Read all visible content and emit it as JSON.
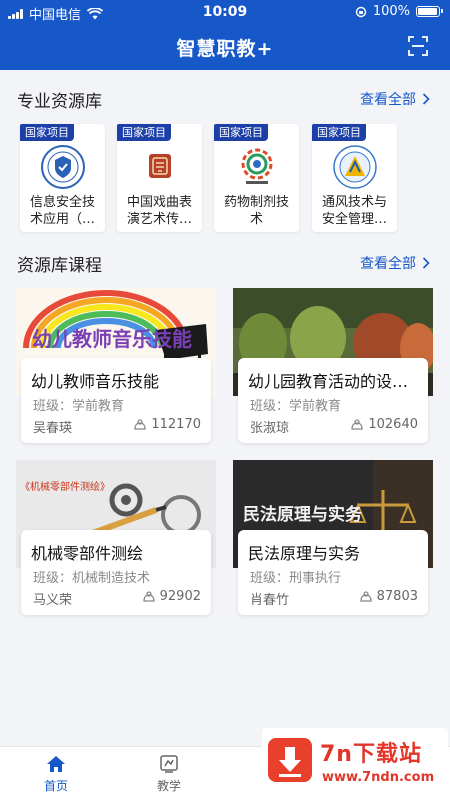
{
  "status": {
    "carrier": "中国电信",
    "time": "10:09",
    "battery": "100%"
  },
  "nav": {
    "title": "智慧职教+"
  },
  "section_resources": {
    "title": "专业资源库",
    "more": "查看全部"
  },
  "resources": [
    {
      "tag": "国家项目",
      "name": "信息安全技术应用（…"
    },
    {
      "tag": "国家项目",
      "name": "中国戏曲表演艺术传…"
    },
    {
      "tag": "国家项目",
      "name": "药物制剂技术"
    },
    {
      "tag": "国家项目",
      "name": "通风技术与安全管理…"
    }
  ],
  "section_courses": {
    "title": "资源库课程",
    "more": "查看全部"
  },
  "courses": [
    {
      "title": "幼儿教师音乐技能",
      "class_label": "班级：学前教育",
      "teacher": "吴春瑛",
      "views": "112170",
      "image_text": "幼儿教师音乐技能"
    },
    {
      "title": "幼儿园教育活动的设…",
      "class_label": "班级：学前教育",
      "teacher": "张淑琼",
      "views": "102640"
    },
    {
      "title": "机械零部件测绘",
      "class_label": "班级：机械制造技术",
      "teacher": "马义荣",
      "views": "92902",
      "image_text": "《机械零部件测绘》"
    },
    {
      "title": "民法原理与实务",
      "class_label": "班级：刑事执行",
      "teacher": "肖春竹",
      "views": "87803",
      "image_text": "民法原理与实务"
    }
  ],
  "tabs": [
    {
      "label": "首页",
      "icon": "home-icon",
      "active": true
    },
    {
      "label": "教学",
      "icon": "teach-icon",
      "active": false
    }
  ],
  "watermark": {
    "text": "7n下载站",
    "url": "www.7ndn.com"
  },
  "colors": {
    "primary": "#1758c9",
    "tag": "#1c3fa8",
    "watermark": "#e3362a"
  }
}
